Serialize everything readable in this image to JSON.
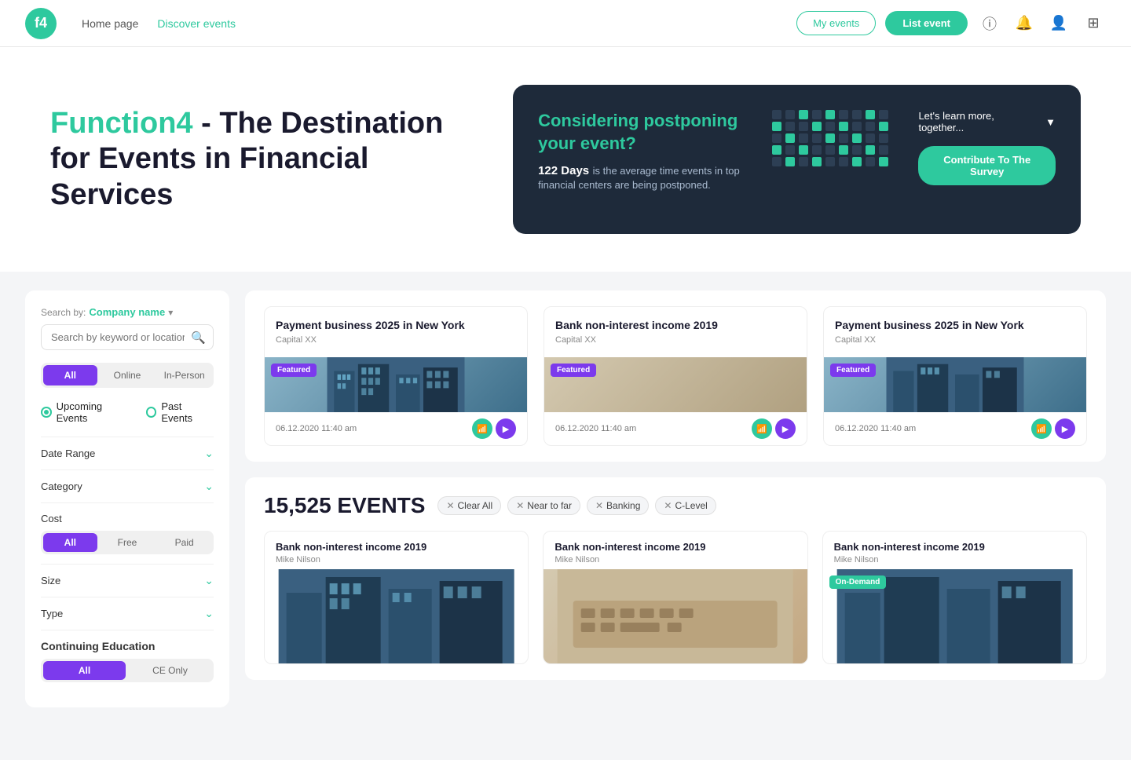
{
  "navbar": {
    "logo_text": "f4",
    "links": [
      {
        "label": "Home page",
        "active": false
      },
      {
        "label": "Discover events",
        "active": true
      }
    ],
    "my_events_label": "My events",
    "list_event_label": "List event"
  },
  "hero": {
    "brand": "Function4",
    "title_rest": " - The Destination for Events in Financial Services",
    "banner": {
      "title": "Considering postponing your event?",
      "stat_bold": "122 Days",
      "stat_rest": " is the average time events in top financial centers are being postponed.",
      "side_title": "Let's learn more, together...",
      "survey_label": "Contribute To The Survey"
    }
  },
  "sidebar": {
    "search_by_label": "Search by:",
    "search_by_value": "Company name",
    "search_placeholder": "Search by keyword or location...",
    "filter_tabs": [
      "All",
      "Online",
      "In-Person"
    ],
    "active_filter_tab": 0,
    "radio_options": [
      "Upcoming Events",
      "Past Events"
    ],
    "active_radio": 0,
    "sections": [
      {
        "label": "Date Range"
      },
      {
        "label": "Category"
      },
      {
        "label": "Size"
      },
      {
        "label": "Type"
      }
    ],
    "cost_label": "Cost",
    "cost_tabs": [
      "All",
      "Free",
      "Paid"
    ],
    "active_cost_tab": 0,
    "cont_edu_label": "Continuing Education",
    "cont_edu_tabs": [
      "All",
      "CE Only"
    ],
    "active_cont_edu_tab": 0
  },
  "featured_cards": [
    {
      "title": "Payment business 2025 in New York",
      "org": "Capital XX",
      "badge": "Featured",
      "date": "06.12.2020 11:40 am",
      "img_type": "buildings"
    },
    {
      "title": "Bank non-interest income 2019",
      "org": "Capital XX",
      "badge": "Featured",
      "date": "06.12.2020 11:40 am",
      "img_type": "keyboard"
    },
    {
      "title": "Payment business 2025 in New York",
      "org": "Capital XX",
      "badge": "Featured",
      "date": "06.12.2020 11:40 am",
      "img_type": "buildings"
    }
  ],
  "all_events": {
    "count": "15,525",
    "count_label": "EVENTS",
    "filter_tags": [
      "Clear All",
      "Near to far",
      "Banking",
      "C-Level"
    ],
    "cards": [
      {
        "title": "Bank non-interest income 2019",
        "org": "Mike Nilson",
        "img_type": "buildings",
        "badge": null
      },
      {
        "title": "Bank non-interest income 2019",
        "org": "Mike Nilson",
        "img_type": "keyboard",
        "badge": null
      },
      {
        "title": "Bank non-interest income 2019",
        "org": "Mike Nilson",
        "img_type": "buildings",
        "badge": "On-Demand"
      }
    ]
  }
}
